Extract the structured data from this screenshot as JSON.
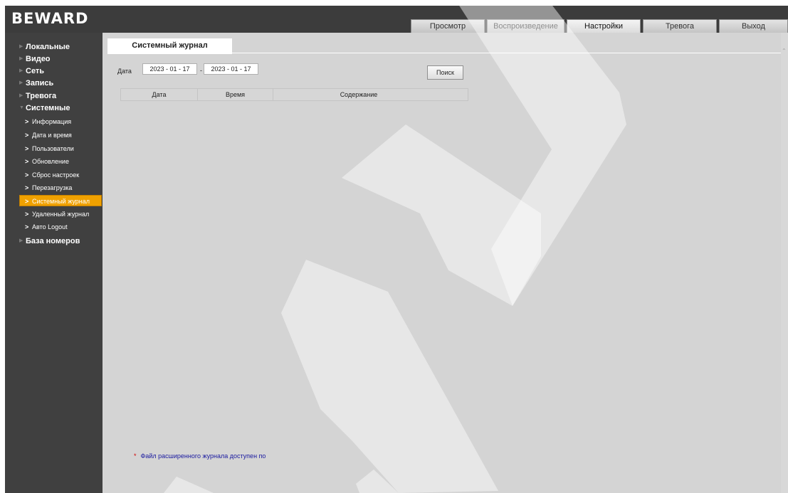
{
  "brand": {
    "logo_text": "BEWARD"
  },
  "top_tabs": [
    {
      "label": "Просмотр",
      "active": false
    },
    {
      "label": "Воспроизведение",
      "active": false
    },
    {
      "label": "Настройки",
      "active": true
    },
    {
      "label": "Тревога",
      "active": false
    },
    {
      "label": "Выход",
      "active": false
    }
  ],
  "sidebar": {
    "items": [
      {
        "label": "Локальные"
      },
      {
        "label": "Видео"
      },
      {
        "label": "Сеть"
      },
      {
        "label": "Запись"
      },
      {
        "label": "Тревога"
      },
      {
        "label": "Системные",
        "expanded": true
      },
      {
        "label": "База номеров"
      }
    ],
    "sub_items": [
      {
        "label": "Информация"
      },
      {
        "label": "Дата и время"
      },
      {
        "label": "Пользователи"
      },
      {
        "label": "Обновление"
      },
      {
        "label": "Сброс настроек"
      },
      {
        "label": "Перезагрузка"
      },
      {
        "label": "Системный журнал",
        "active": true
      },
      {
        "label": "Удаленный журнал"
      },
      {
        "label": "Авто Logout"
      }
    ]
  },
  "page": {
    "tab_title": "Системный журнал",
    "date_label": "Дата",
    "date_from": "2023 - 01 - 17",
    "date_separator": "-",
    "date_to": "2023 - 01 - 17",
    "search_button": "Поиск",
    "table_headers": [
      "Дата",
      "Время",
      "Содержание"
    ],
    "footnote_mark": "*",
    "footnote": "Файл расширенного журнала доступен по"
  },
  "colors": {
    "header_bg": "#3c3c3c",
    "sidebar_bg": "#404040",
    "content_bg": "#d4d4d4",
    "active_item": "#f0a100",
    "footnote_text": "#1a1aa0"
  },
  "icons": {
    "nav_arrow": "triangle-right-icon",
    "sub_chevron": "chevron-right-icon",
    "scroll_up": "chevron-up-icon"
  }
}
